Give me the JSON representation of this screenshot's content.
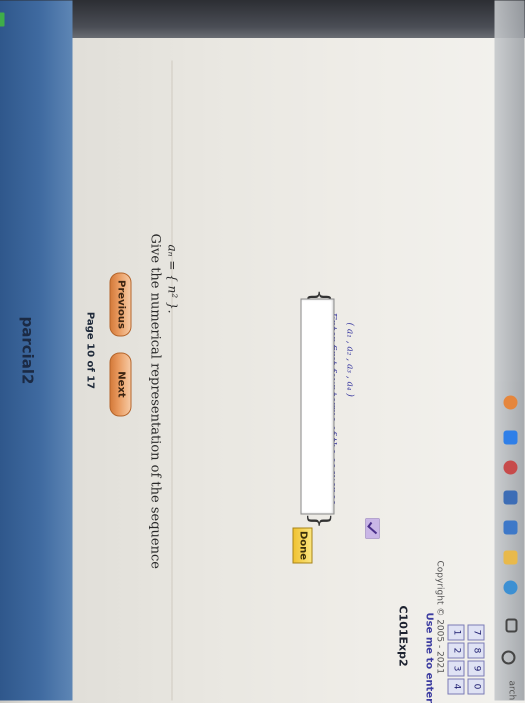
{
  "header": {
    "title": "parcial2",
    "page_indicator": "Page 10 of 17"
  },
  "nav": {
    "previous_label": "Previous",
    "next_label": "Next"
  },
  "question": {
    "text": "Give the numerical representation of the sequence",
    "formula": "aₙ = { n² }."
  },
  "input": {
    "hint": "Enter first four terms of the sequence",
    "hint_sub": "( a₁ , a₂ , a₃ , a₄ )",
    "value": ""
  },
  "done_label": "Done",
  "side_panel": {
    "code": "C101Exp2",
    "use_me_label": "Use me to enter",
    "keys_row1": [
      "1",
      "2",
      "3",
      "4"
    ],
    "keys_row2": [
      "7",
      "8",
      "9",
      "0"
    ]
  },
  "footer": {
    "copyright": "Copyright © 2005 - 2021"
  },
  "taskbar": {
    "search_label": "arch"
  }
}
